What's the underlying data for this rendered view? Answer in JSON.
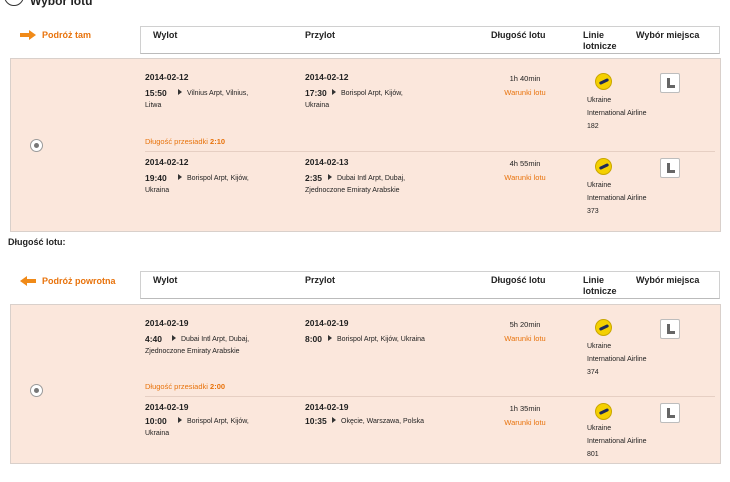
{
  "page": {
    "title": "Wybór lotu",
    "step": "1"
  },
  "columns": {
    "departure": "Wylot",
    "arrival": "Przylot",
    "duration": "Długość lotu",
    "airlines": "Linie lotnicze",
    "seat": "Wybór miejsca"
  },
  "outbound": {
    "label": "Podróż tam",
    "segments": [
      {
        "dep_date": "2014-02-12",
        "dep_time": "15:50",
        "dep_place": "Vilnius Arpt, Vilnius,",
        "dep_place2": "Litwa",
        "arr_date": "2014-02-12",
        "arr_time": "17:30",
        "arr_place": "Borispol Arpt, Kijów,",
        "arr_place2": "Ukraina",
        "duration": "1h 40min",
        "terms": "Warunki lotu",
        "airline1": "Ukraine",
        "airline2": "International Airline",
        "flight_no": "182"
      },
      {
        "dep_date": "2014-02-12",
        "dep_time": "19:40",
        "dep_place": "Borispol Arpt, Kijów,",
        "dep_place2": "Ukraina",
        "arr_date": "2014-02-13",
        "arr_time": "2:35",
        "arr_place": "Dubai Intl Arpt, Dubaj,",
        "arr_place2": "Zjednoczone Emiraty Arabskie",
        "duration": "4h 55min",
        "terms": "Warunki lotu",
        "airline1": "Ukraine",
        "airline2": "International Airline",
        "flight_no": "373"
      }
    ],
    "layover_label": "Długość przesiadki",
    "layover_value": "2:10"
  },
  "total_label": "Długość lotu:",
  "inbound": {
    "label": "Podróż powrotna",
    "segments": [
      {
        "dep_date": "2014-02-19",
        "dep_time": "4:40",
        "dep_place": "Dubai Intl Arpt, Dubaj,",
        "dep_place2": "Zjednoczone Emiraty Arabskie",
        "arr_date": "2014-02-19",
        "arr_time": "8:00",
        "arr_place": "Borispol Arpt, Kijów, Ukraina",
        "arr_place2": "",
        "duration": "5h 20min",
        "terms": "Warunki lotu",
        "airline1": "Ukraine",
        "airline2": "International Airline",
        "flight_no": "374"
      },
      {
        "dep_date": "2014-02-19",
        "dep_time": "10:00",
        "dep_place": "Borispol Arpt, Kijów,",
        "dep_place2": "Ukraina",
        "arr_date": "2014-02-19",
        "arr_time": "10:35",
        "arr_place": "Okęcie, Warszawa, Polska",
        "arr_place2": "",
        "duration": "1h 35min",
        "terms": "Warunki lotu",
        "airline1": "Ukraine",
        "airline2": "International Airline",
        "flight_no": "801"
      }
    ],
    "layover_label": "Długość przesiadki",
    "layover_value": "2:00"
  },
  "colors": {
    "accent": "#e8730c",
    "panel": "#fbe7dc"
  }
}
